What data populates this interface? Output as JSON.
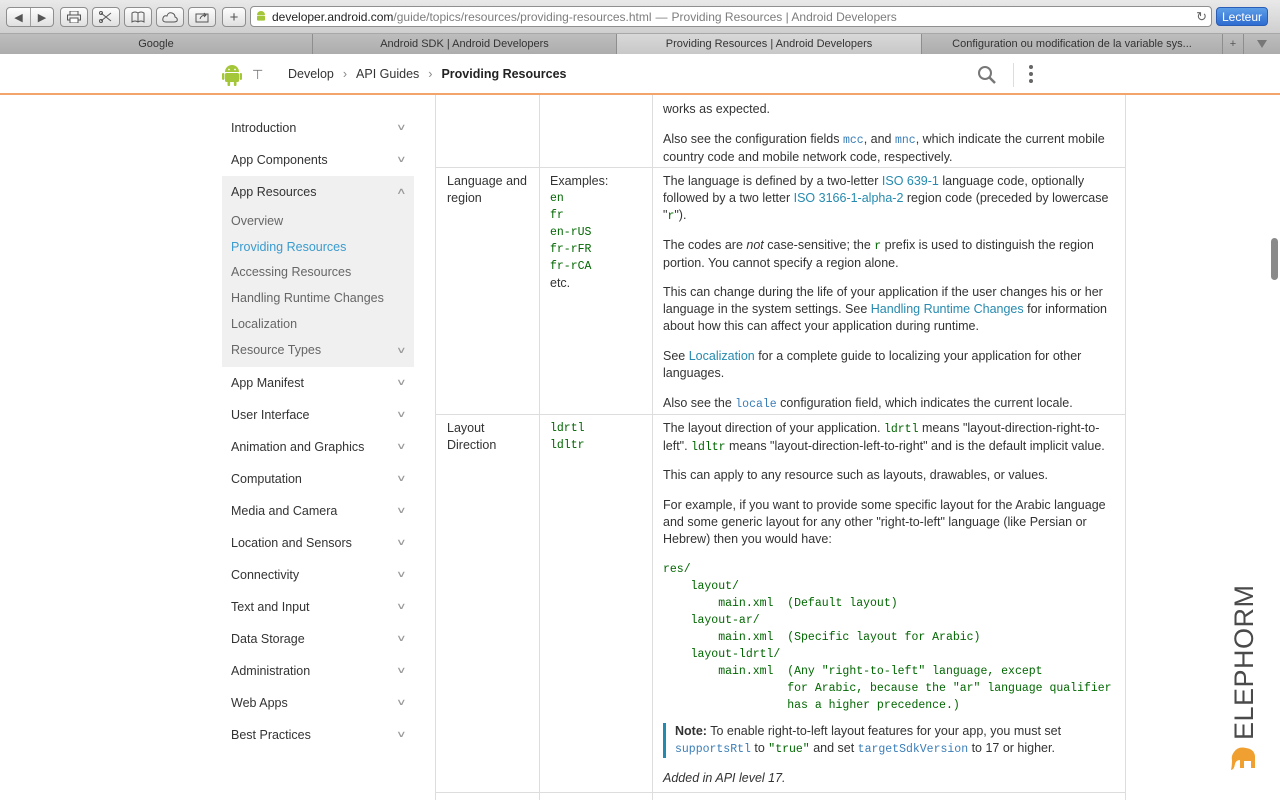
{
  "browser": {
    "url_host": "developer.android.com",
    "url_path": "/guide/topics/resources/providing-resources.html",
    "url_separator": "—",
    "page_title": "Providing Resources | Android Developers",
    "reader_label": "Lecteur",
    "tabs": [
      {
        "label": "Google"
      },
      {
        "label": "Android SDK | Android Developers"
      },
      {
        "label": "Providing Resources | Android Developers"
      },
      {
        "label": "Configuration ou modification de la variable sys..."
      }
    ]
  },
  "header": {
    "breadcrumb": [
      "Develop",
      "API Guides",
      "Providing Resources"
    ],
    "breadcrumb_sep": "›",
    "menu_glyph": "⊤"
  },
  "sidebar": {
    "items_top": [
      {
        "label": "Introduction"
      },
      {
        "label": "App Components"
      }
    ],
    "expanded": {
      "label": "App Resources",
      "children": [
        {
          "label": "Overview"
        },
        {
          "label": "Providing Resources"
        },
        {
          "label": "Accessing Resources"
        },
        {
          "label": "Handling Runtime Changes"
        },
        {
          "label": "Localization"
        },
        {
          "label": "Resource Types"
        }
      ]
    },
    "items_bottom": [
      {
        "label": "App Manifest"
      },
      {
        "label": "User Interface"
      },
      {
        "label": "Animation and Graphics"
      },
      {
        "label": "Computation"
      },
      {
        "label": "Media and Camera"
      },
      {
        "label": "Location and Sensors"
      },
      {
        "label": "Connectivity"
      },
      {
        "label": "Text and Input"
      },
      {
        "label": "Data Storage"
      },
      {
        "label": "Administration"
      },
      {
        "label": "Web Apps"
      },
      {
        "label": "Best Practices"
      }
    ]
  },
  "table": {
    "mcc_row": {
      "partial_top": "works as expected.",
      "also_pre": "Also see the configuration fields ",
      "mcc": "mcc",
      "and": ", and ",
      "mnc": "mnc",
      "also_post": ", which indicate the current mobile country code and mobile network code, respectively."
    },
    "language_row": {
      "name_line1": "Language and",
      "name_line2": "region",
      "examples_label": "Examples:",
      "examples": [
        "en",
        "fr",
        "en-rUS",
        "fr-rFR",
        "fr-rCA"
      ],
      "examples_more": "etc.",
      "p1_a": "The language is defined by a two-letter ",
      "p1_link1": "ISO 639-1",
      "p1_b": " language code, optionally followed by a two letter ",
      "p1_link2": "ISO 3166-1-alpha-2",
      "p1_c": " region code (preceded by lowercase \"",
      "p1_code": "r",
      "p1_d": "\").",
      "p2_a": "The codes are ",
      "p2_em": "not",
      "p2_b": " case-sensitive; the ",
      "p2_code": "r",
      "p2_c": " prefix is used to distinguish the region portion. You cannot specify a region alone.",
      "p3_a": "This can change during the life of your application if the user changes his or her language in the system settings. See ",
      "p3_link": "Handling Runtime Changes",
      "p3_b": " for information about how this can affect your application during runtime.",
      "p4_a": "See ",
      "p4_link": "Localization",
      "p4_b": " for a complete guide to localizing your application for other languages.",
      "p5_a": "Also see the ",
      "p5_code": "locale",
      "p5_b": " configuration field, which indicates the current locale."
    },
    "layout_row": {
      "name_line1": "Layout",
      "name_line2": "Direction",
      "values": [
        "ldrtl",
        "ldltr"
      ],
      "p1_a": "The layout direction of your application. ",
      "p1_code1": "ldrtl",
      "p1_b": " means \"layout-direction-right-to-left\". ",
      "p1_code2": "ldltr",
      "p1_c": " means \"layout-direction-left-to-right\" and is the default implicit value.",
      "p2": "This can apply to any resource such as layouts, drawables, or values.",
      "p3": "For example, if you want to provide some specific layout for the Arabic language and some generic layout for any other \"right-to-left\" language (like Persian or Hebrew) then you would have:",
      "code": "res/\n    layout/\n        main.xml  (Default layout)\n    layout-ar/\n        main.xml  (Specific layout for Arabic)\n    layout-ldrtl/\n        main.xml  (Any \"right-to-left\" language, except\n                  for Arabic, because the \"ar\" language qualifier\n                  has a higher precedence.)",
      "note_label": "Note:",
      "note_a": " To enable right-to-left layout features for your app, you must set ",
      "note_code1": "supportsRtl",
      "note_b": " to ",
      "note_code2": "\"true\"",
      "note_c": " and set ",
      "note_code3": "targetSdkVersion",
      "note_d": " to 17 or higher.",
      "added": "Added in API level 17."
    }
  },
  "watermark": "ELEPHORM",
  "colors": {
    "accent_link": "#258aaf",
    "header_border": "#f3a46b",
    "android_green": "#a4c639",
    "watermark_orange": "#f0a030"
  }
}
